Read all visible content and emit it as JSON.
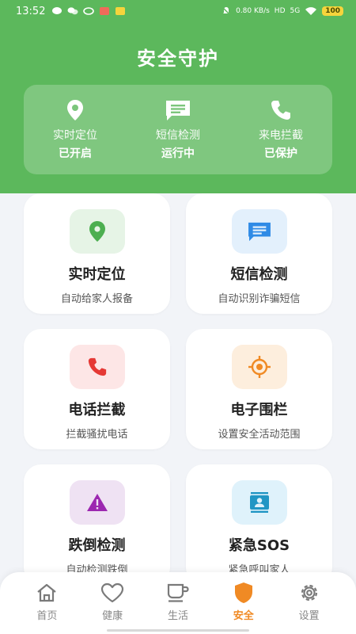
{
  "status_bar": {
    "time": "13:52",
    "network_speed": "0.80 KB/s",
    "hd": "HD",
    "signal": "5G",
    "battery": "100"
  },
  "header": {
    "title": "安全守护",
    "summary": [
      {
        "icon": "location-pin-icon",
        "label": "实时定位",
        "status": "已开启"
      },
      {
        "icon": "message-icon",
        "label": "短信检测",
        "status": "运行中"
      },
      {
        "icon": "phone-icon",
        "label": "来电拦截",
        "status": "已保护"
      }
    ]
  },
  "features": [
    {
      "icon": "location-pin-icon",
      "title": "实时定位",
      "desc": "自动给家人报备",
      "icon_bg": "#e6f4e6",
      "icon_color": "#4caf50"
    },
    {
      "icon": "message-icon",
      "title": "短信检测",
      "desc": "自动识别诈骗短信",
      "icon_bg": "#e3f0fc",
      "icon_color": "#2f8be6"
    },
    {
      "icon": "phone-icon",
      "title": "电话拦截",
      "desc": "拦截骚扰电话",
      "icon_bg": "#fde6e6",
      "icon_color": "#e53935"
    },
    {
      "icon": "target-icon",
      "title": "电子围栏",
      "desc": "设置安全活动范围",
      "icon_bg": "#fdeedd",
      "icon_color": "#f08a24"
    },
    {
      "icon": "warning-icon",
      "title": "跌倒检测",
      "desc": "自动检测跌倒",
      "icon_bg": "#efe2f3",
      "icon_color": "#9c27b0"
    },
    {
      "icon": "contact-card-icon",
      "title": "紧急SOS",
      "desc": "紧急呼叫家人",
      "icon_bg": "#dff2fb",
      "icon_color": "#2196c4"
    }
  ],
  "nav": [
    {
      "icon": "home-icon",
      "label": "首页",
      "active": false
    },
    {
      "icon": "heart-icon",
      "label": "健康",
      "active": false
    },
    {
      "icon": "cup-icon",
      "label": "生活",
      "active": false
    },
    {
      "icon": "shield-icon",
      "label": "安全",
      "active": true
    },
    {
      "icon": "gear-icon",
      "label": "设置",
      "active": false
    }
  ],
  "colors": {
    "brand_green": "#5cb85c",
    "accent_orange": "#f08a24",
    "background": "#f2f4f8"
  }
}
